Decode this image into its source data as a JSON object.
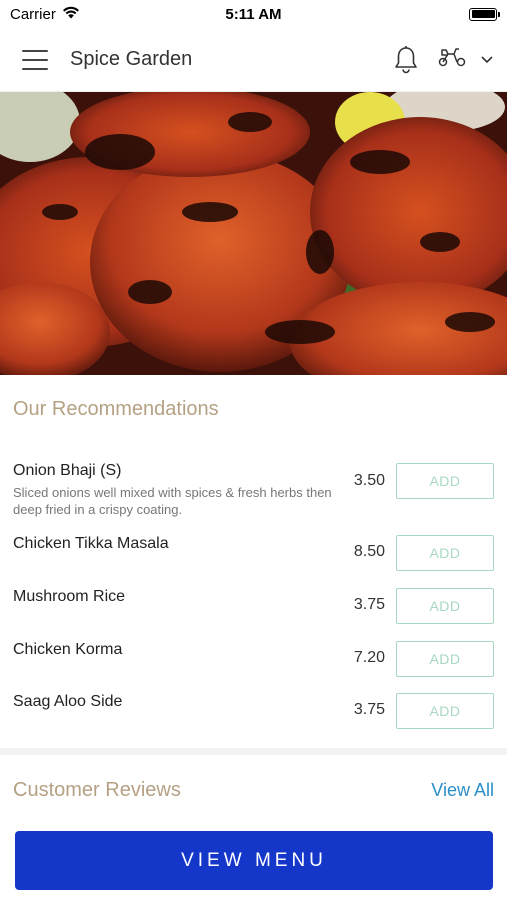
{
  "status_bar": {
    "carrier": "Carrier",
    "time": "5:11 AM"
  },
  "header": {
    "title": "Spice Garden",
    "icons": [
      "menu-icon",
      "bell-icon",
      "scooter-icon",
      "chevron-down-icon"
    ]
  },
  "hero": {
    "image": "tandoori-chicken-photo"
  },
  "recommendations": {
    "title": "Our Recommendations",
    "items": [
      {
        "name": "Onion Bhaji (S)",
        "description": "Sliced onions well mixed with spices & fresh herbs then deep fried in a crispy coating.",
        "price": "3.50",
        "button": "ADD"
      },
      {
        "name": "Chicken Tikka Masala",
        "description": "",
        "price": "8.50",
        "button": "ADD"
      },
      {
        "name": "Mushroom Rice",
        "description": "",
        "price": "3.75",
        "button": "ADD"
      },
      {
        "name": "Chicken Korma",
        "description": "",
        "price": "7.20",
        "button": "ADD"
      },
      {
        "name": "Saag Aloo Side",
        "description": "",
        "price": "3.75",
        "button": "ADD"
      }
    ]
  },
  "reviews": {
    "title": "Customer Reviews",
    "view_all": "View All"
  },
  "footer": {
    "view_menu": "VIEW MENU"
  },
  "colors": {
    "accent": "#1436c9",
    "section_title": "#b5a184",
    "add_border": "#a8d8c0",
    "link": "#2a8fc9"
  }
}
